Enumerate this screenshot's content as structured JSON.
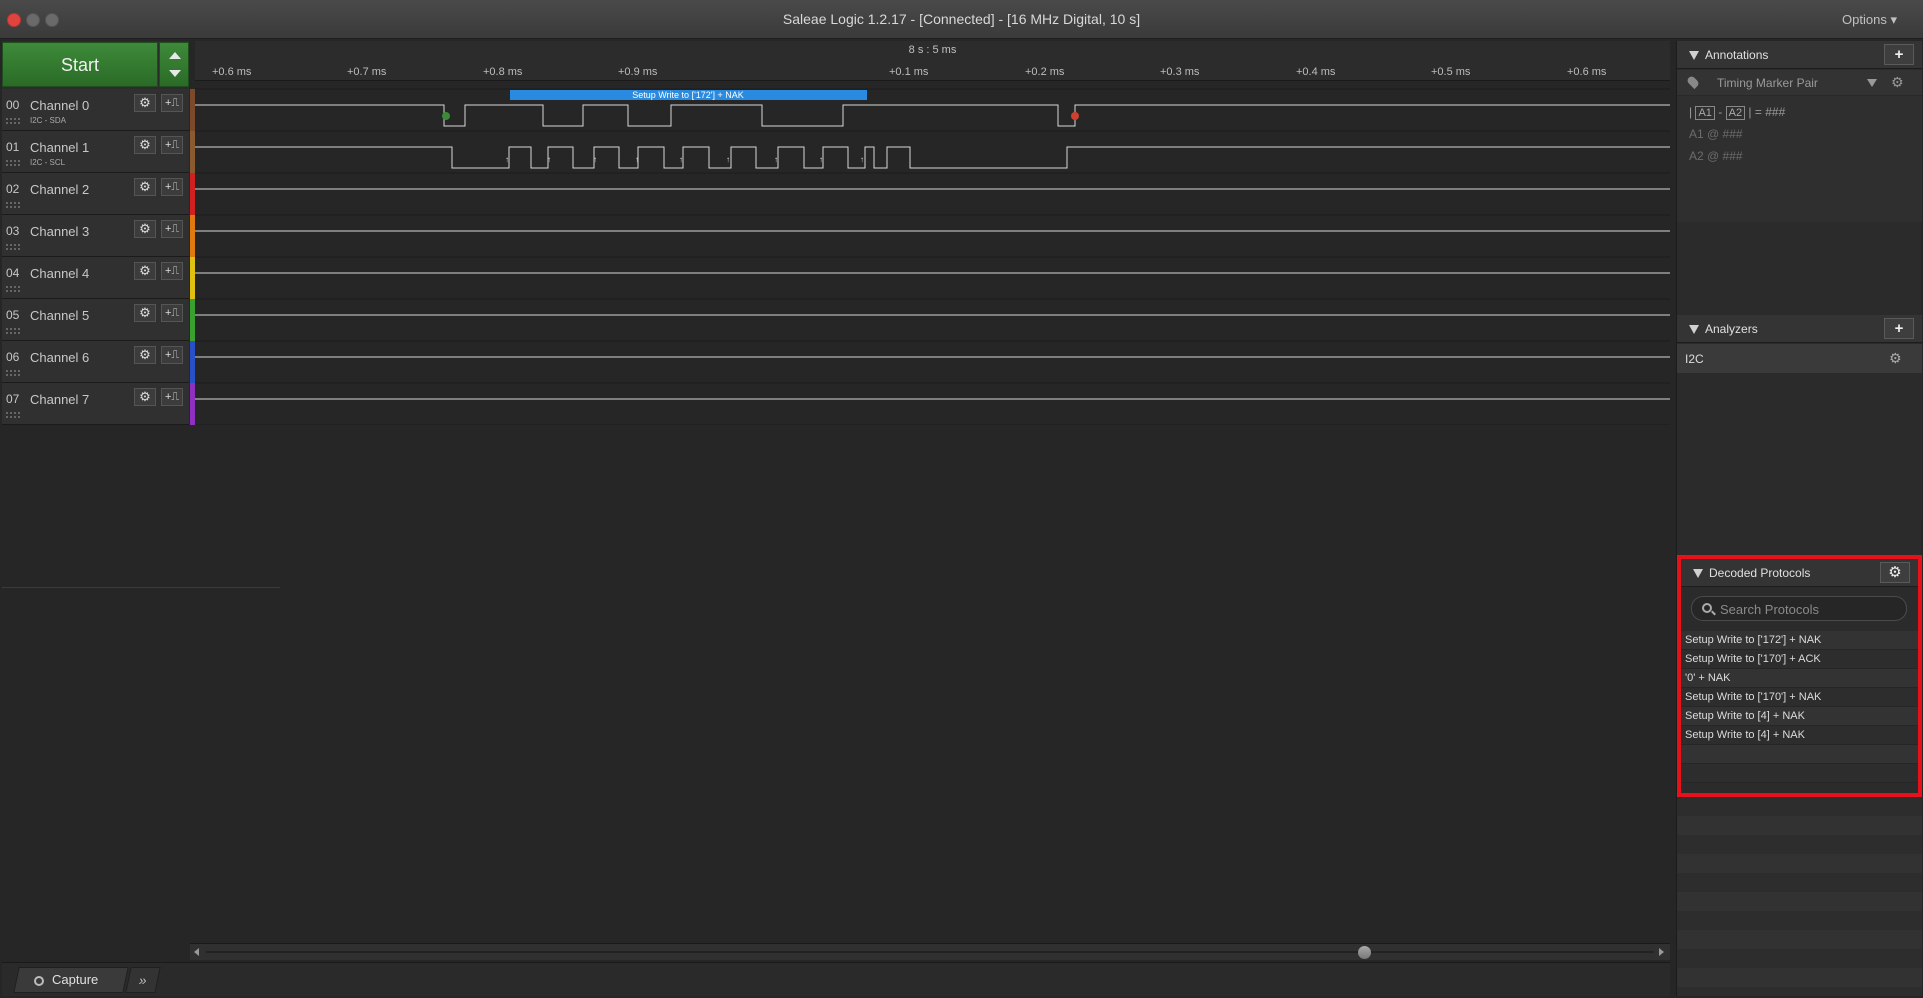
{
  "window": {
    "title": "Saleae Logic 1.2.17 - [Connected] - [16 MHz Digital, 10 s]",
    "options_label": "Options ▾"
  },
  "toolbar": {
    "start_label": "Start"
  },
  "timeline": {
    "center_label": "8 s : 5 ms",
    "ticks": [
      "+0.6 ms",
      "+0.7 ms",
      "+0.8 ms",
      "+0.9 ms",
      "+0.1 ms",
      "+0.2 ms",
      "+0.3 ms",
      "+0.4 ms",
      "+0.5 ms",
      "+0.6 ms"
    ]
  },
  "channels": [
    {
      "num": "00",
      "name": "Channel 0",
      "sub": "I2C - SDA",
      "color": "#7a4a2a"
    },
    {
      "num": "01",
      "name": "Channel 1",
      "sub": "I2C - SCL",
      "color": "#8a5a30"
    },
    {
      "num": "02",
      "name": "Channel 2",
      "sub": "",
      "color": "#d02020"
    },
    {
      "num": "03",
      "name": "Channel 3",
      "sub": "",
      "color": "#e07a10"
    },
    {
      "num": "04",
      "name": "Channel 4",
      "sub": "",
      "color": "#e0c010"
    },
    {
      "num": "05",
      "name": "Channel 5",
      "sub": "",
      "color": "#3aa030"
    },
    {
      "num": "06",
      "name": "Channel 6",
      "sub": "",
      "color": "#2a50c8"
    },
    {
      "num": "07",
      "name": "Channel 7",
      "sub": "",
      "color": "#9030c0"
    }
  ],
  "decoded_bubble": "Setup Write to ['172'] + NAK",
  "bottom": {
    "capture_label": "Capture",
    "more_label": "»"
  },
  "annotations": {
    "title": "Annotations",
    "add_label": "+",
    "marker_label": "Timing Marker Pair",
    "formula_a1": "A1",
    "formula_a2": "A2",
    "formula_sep": "-",
    "formula_result": "= ###",
    "a1_line": "A1  @  ###",
    "a2_line": "A2  @  ###"
  },
  "analyzers": {
    "title": "Analyzers",
    "add_label": "+",
    "items": [
      "I2C"
    ]
  },
  "decoded_protocols": {
    "title": "Decoded Protocols",
    "search_placeholder": "Search Protocols",
    "items": [
      "Setup Write to ['172'] + NAK",
      "Setup Write to ['170'] + ACK",
      "'0' + NAK",
      "Setup Write to ['170'] + NAK",
      "Setup Write to [4] + NAK",
      "Setup Write to [4] + NAK"
    ]
  },
  "colors": {
    "start_green": "#2f7a2c",
    "highlight_red": "#e8101a",
    "decode_blue": "#2a8ae0"
  }
}
